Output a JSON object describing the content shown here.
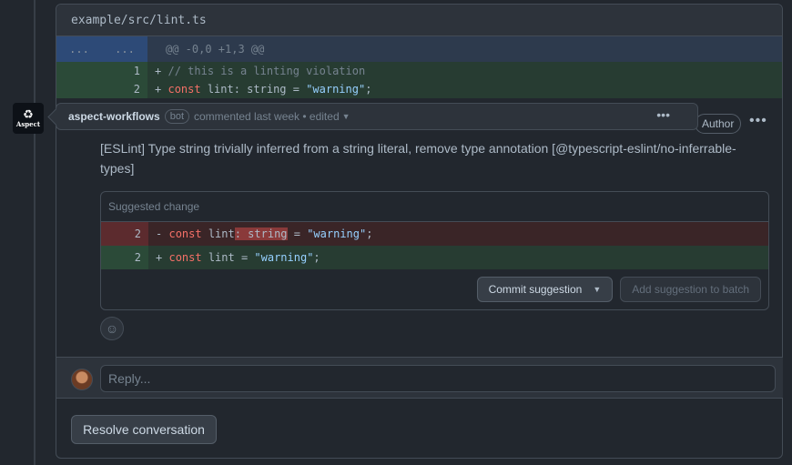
{
  "file": {
    "path": "example/src/lint.ts",
    "hunk_left": "...",
    "hunk_right": "...",
    "hunk_header": "@@ -0,0 +1,3 @@",
    "lines": [
      {
        "num": "1",
        "sign": "+",
        "comment": "// this is a linting violation"
      },
      {
        "num": "2",
        "sign": "+",
        "kw": "const",
        "mid": " lint: string = ",
        "str": "\"warning\"",
        "end": ";"
      }
    ]
  },
  "comment": {
    "avatar_text": "Aspect",
    "username": "aspect-workflows",
    "badge": "bot",
    "meta": "commented last week • edited",
    "author_label": "Author",
    "body": "[ESLint] Type string trivially inferred from a string literal, remove type annotation [@typescript-eslint/no-inferrable-types]"
  },
  "suggestion": {
    "title": "Suggested change",
    "del_num": "2",
    "del_sign": "-",
    "del_kw": "const",
    "del_pre": " lint",
    "del_hl": ": string",
    "del_mid": " = ",
    "del_str": "\"warning\"",
    "del_end": ";",
    "add_num": "2",
    "add_sign": "+",
    "add_kw": "const",
    "add_mid": " lint = ",
    "add_str": "\"warning\"",
    "add_end": ";",
    "commit_label": "Commit suggestion",
    "batch_label": "Add suggestion to batch"
  },
  "reply": {
    "placeholder": "Reply..."
  },
  "resolve_label": "Resolve conversation",
  "colors": {
    "bg": "#22272e",
    "add": "#273c32",
    "del": "#3a2527",
    "accent_str": "#96d0ff",
    "accent_kw": "#f47067"
  }
}
